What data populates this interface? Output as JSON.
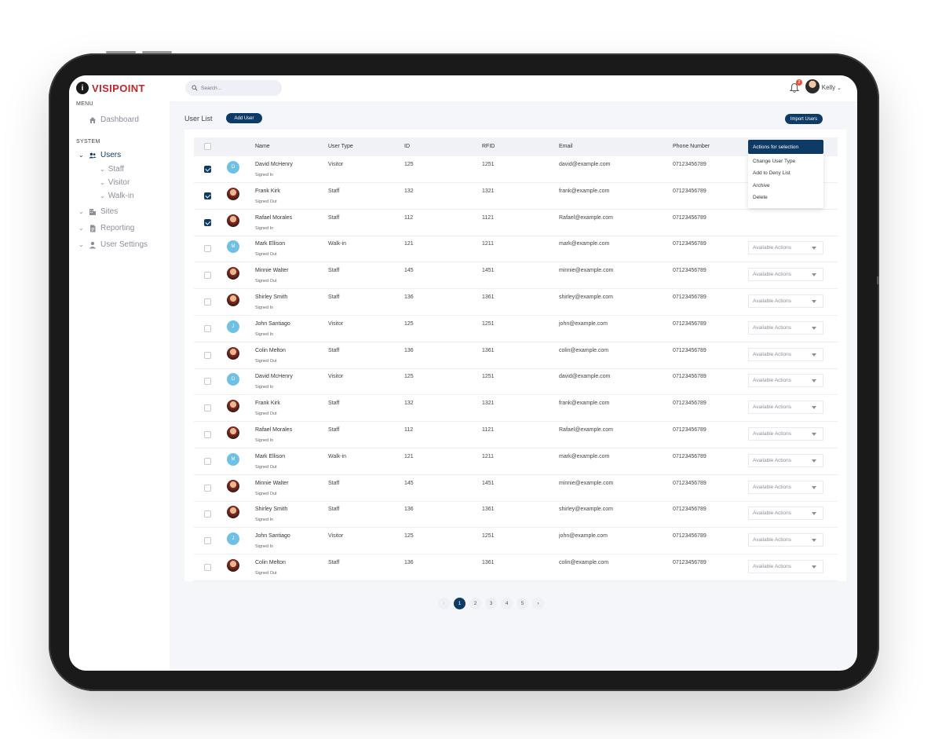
{
  "app": {
    "brand": "VISIPOINT",
    "brand_mark": "i"
  },
  "sidebar": {
    "menu_label": "MENU",
    "dashboard": "Dashboard",
    "system_label": "SYSTEM",
    "users": "Users",
    "users_sub": [
      "Staff",
      "Visitor",
      "Walk-in"
    ],
    "sites": "Sites",
    "reporting": "Reporting",
    "user_settings": "User Settings"
  },
  "topbar": {
    "search_placeholder": "Search...",
    "notification_count": "2",
    "user_name": "Kelly"
  },
  "page": {
    "title": "User List",
    "add_user": "Add User",
    "import_users": "Import Users"
  },
  "table": {
    "columns": {
      "name": "Name",
      "user_type": "User Type",
      "id": "ID",
      "rfid": "RFID",
      "email": "Email",
      "phone": "Phone Number"
    },
    "action_default": "Available Actions",
    "rows": [
      {
        "name": "David McHenry",
        "status": "Signed In",
        "type": "Visitor",
        "id": "125",
        "rfid": "1251",
        "email": "david@example.com",
        "phone": "07123456789",
        "initial": "D",
        "checked": true
      },
      {
        "name": "Frank Kirk",
        "status": "Signed Out",
        "type": "Staff",
        "id": "132",
        "rfid": "1321",
        "email": "frank@example.com",
        "phone": "07123456789",
        "initial": "",
        "checked": true
      },
      {
        "name": "Rafael Morales",
        "status": "Signed In",
        "type": "Staff",
        "id": "112",
        "rfid": "1121",
        "email": "Rafael@example.com",
        "phone": "07123456789",
        "initial": "",
        "checked": true
      },
      {
        "name": "Mark Ellison",
        "status": "Signed Out",
        "type": "Walk-in",
        "id": "121",
        "rfid": "1211",
        "email": "mark@example.com",
        "phone": "07123456789",
        "initial": "M",
        "checked": false
      },
      {
        "name": "Minnie Walter",
        "status": "Signed Out",
        "type": "Staff",
        "id": "145",
        "rfid": "1451",
        "email": "minnie@example.com",
        "phone": "07123456789",
        "initial": "",
        "checked": false
      },
      {
        "name": "Shirley Smith",
        "status": "Signed In",
        "type": "Staff",
        "id": "136",
        "rfid": "1361",
        "email": "shirley@example.com",
        "phone": "07123456789",
        "initial": "",
        "checked": false
      },
      {
        "name": "John Santiago",
        "status": "Signed In",
        "type": "Visitor",
        "id": "125",
        "rfid": "1251",
        "email": "john@example.com",
        "phone": "07123456789",
        "initial": "J",
        "checked": false
      },
      {
        "name": "Colin Melton",
        "status": "Signed Out",
        "type": "Staff",
        "id": "136",
        "rfid": "1361",
        "email": "colin@example.com",
        "phone": "07123456789",
        "initial": "",
        "checked": false
      },
      {
        "name": "David McHenry",
        "status": "Signed In",
        "type": "Visitor",
        "id": "125",
        "rfid": "1251",
        "email": "david@example.com",
        "phone": "07123456789",
        "initial": "D",
        "checked": false
      },
      {
        "name": "Frank Kirk",
        "status": "Signed Out",
        "type": "Staff",
        "id": "132",
        "rfid": "1321",
        "email": "frank@example.com",
        "phone": "07123456789",
        "initial": "",
        "checked": false
      },
      {
        "name": "Rafael Morales",
        "status": "Signed In",
        "type": "Staff",
        "id": "112",
        "rfid": "1121",
        "email": "Rafael@example.com",
        "phone": "07123456789",
        "initial": "",
        "checked": false
      },
      {
        "name": "Mark Ellison",
        "status": "Signed Out",
        "type": "Walk-in",
        "id": "121",
        "rfid": "1211",
        "email": "mark@example.com",
        "phone": "07123456789",
        "initial": "M",
        "checked": false
      },
      {
        "name": "Minnie Walter",
        "status": "Signed Out",
        "type": "Staff",
        "id": "145",
        "rfid": "1451",
        "email": "minnie@example.com",
        "phone": "07123456789",
        "initial": "",
        "checked": false
      },
      {
        "name": "Shirley Smith",
        "status": "Signed In",
        "type": "Staff",
        "id": "136",
        "rfid": "1361",
        "email": "shirley@example.com",
        "phone": "07123456789",
        "initial": "",
        "checked": false
      },
      {
        "name": "John Santiago",
        "status": "Signed In",
        "type": "Visitor",
        "id": "125",
        "rfid": "1251",
        "email": "john@example.com",
        "phone": "07123456789",
        "initial": "J",
        "checked": false
      },
      {
        "name": "Colin Melton",
        "status": "Signed Out",
        "type": "Staff",
        "id": "136",
        "rfid": "1361",
        "email": "colin@example.com",
        "phone": "07123456789",
        "initial": "",
        "checked": false
      }
    ]
  },
  "actions_menu": {
    "header": "Actions for selection",
    "items": [
      "Change User Type",
      "Add to Deny List",
      "Archive",
      "Delete"
    ]
  },
  "pagination": {
    "pages": [
      "1",
      "2",
      "3",
      "4",
      "5"
    ],
    "current": "1",
    "prev": "‹",
    "next": "›"
  },
  "colors": {
    "primary": "#0d3b66",
    "brand_red": "#c0262d",
    "avatar_blue": "#6ec1e4",
    "badge": "#e5533d"
  }
}
